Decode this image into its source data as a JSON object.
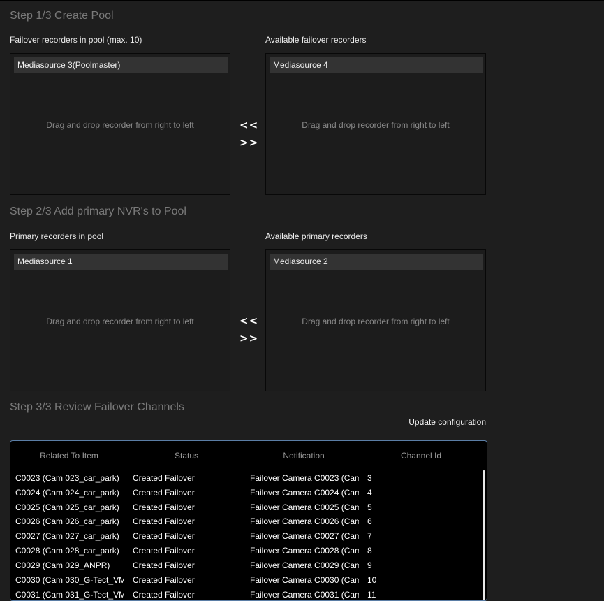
{
  "step1": {
    "title": "Step 1/3 Create Pool",
    "left_label": "Failover recorders in pool (max. 10)",
    "right_label": "Available failover recorders",
    "left_item": "Mediasource 3(Poolmaster)",
    "right_item": "Mediasource 4",
    "hint": "Drag and drop recorder from right to left"
  },
  "step2": {
    "title": "Step 2/3 Add primary NVR's to Pool",
    "left_label": "Primary recorders in pool",
    "right_label": "Available primary recorders",
    "left_item": "Mediasource 1",
    "right_item": "Mediasource 2",
    "hint": "Drag and drop recorder from right to left"
  },
  "arrows": {
    "left": "<<",
    "right": ">>"
  },
  "step3": {
    "title": "Step 3/3 Review Failover Channels",
    "update_label": "Update configuration",
    "columns": [
      "Related To Item",
      "Status",
      "Notification",
      "Channel Id"
    ],
    "rows": [
      [
        "C0023 (Cam 023_car_park)",
        "Created Failover",
        "Failover Camera C0023 (Cam",
        "3"
      ],
      [
        "C0024 (Cam 024_car_park)",
        "Created Failover",
        "Failover Camera C0024 (Cam",
        "4"
      ],
      [
        "C0025 (Cam 025_car_park)",
        "Created Failover",
        "Failover Camera C0025 (Cam",
        "5"
      ],
      [
        "C0026 (Cam 026_car_park)",
        "Created Failover",
        "Failover Camera C0026 (Cam",
        "6"
      ],
      [
        "C0027 (Cam 027_car_park)",
        "Created Failover",
        "Failover Camera C0027 (Cam",
        "7"
      ],
      [
        "C0028 (Cam 028_car_park)",
        "Created Failover",
        "Failover Camera C0028 (Cam",
        "8"
      ],
      [
        "C0029 (Cam 029_ANPR)",
        "Created Failover",
        "Failover Camera C0029 (Cam",
        "9"
      ],
      [
        "C0030 (Cam 030_G-Tect_VM",
        "Created Failover",
        "Failover Camera C0030 (Cam",
        "10"
      ],
      [
        "C0031 (Cam 031_G-Tect_VM",
        "Created Failover",
        "Failover Camera C0031 (Cam",
        "11"
      ]
    ]
  }
}
